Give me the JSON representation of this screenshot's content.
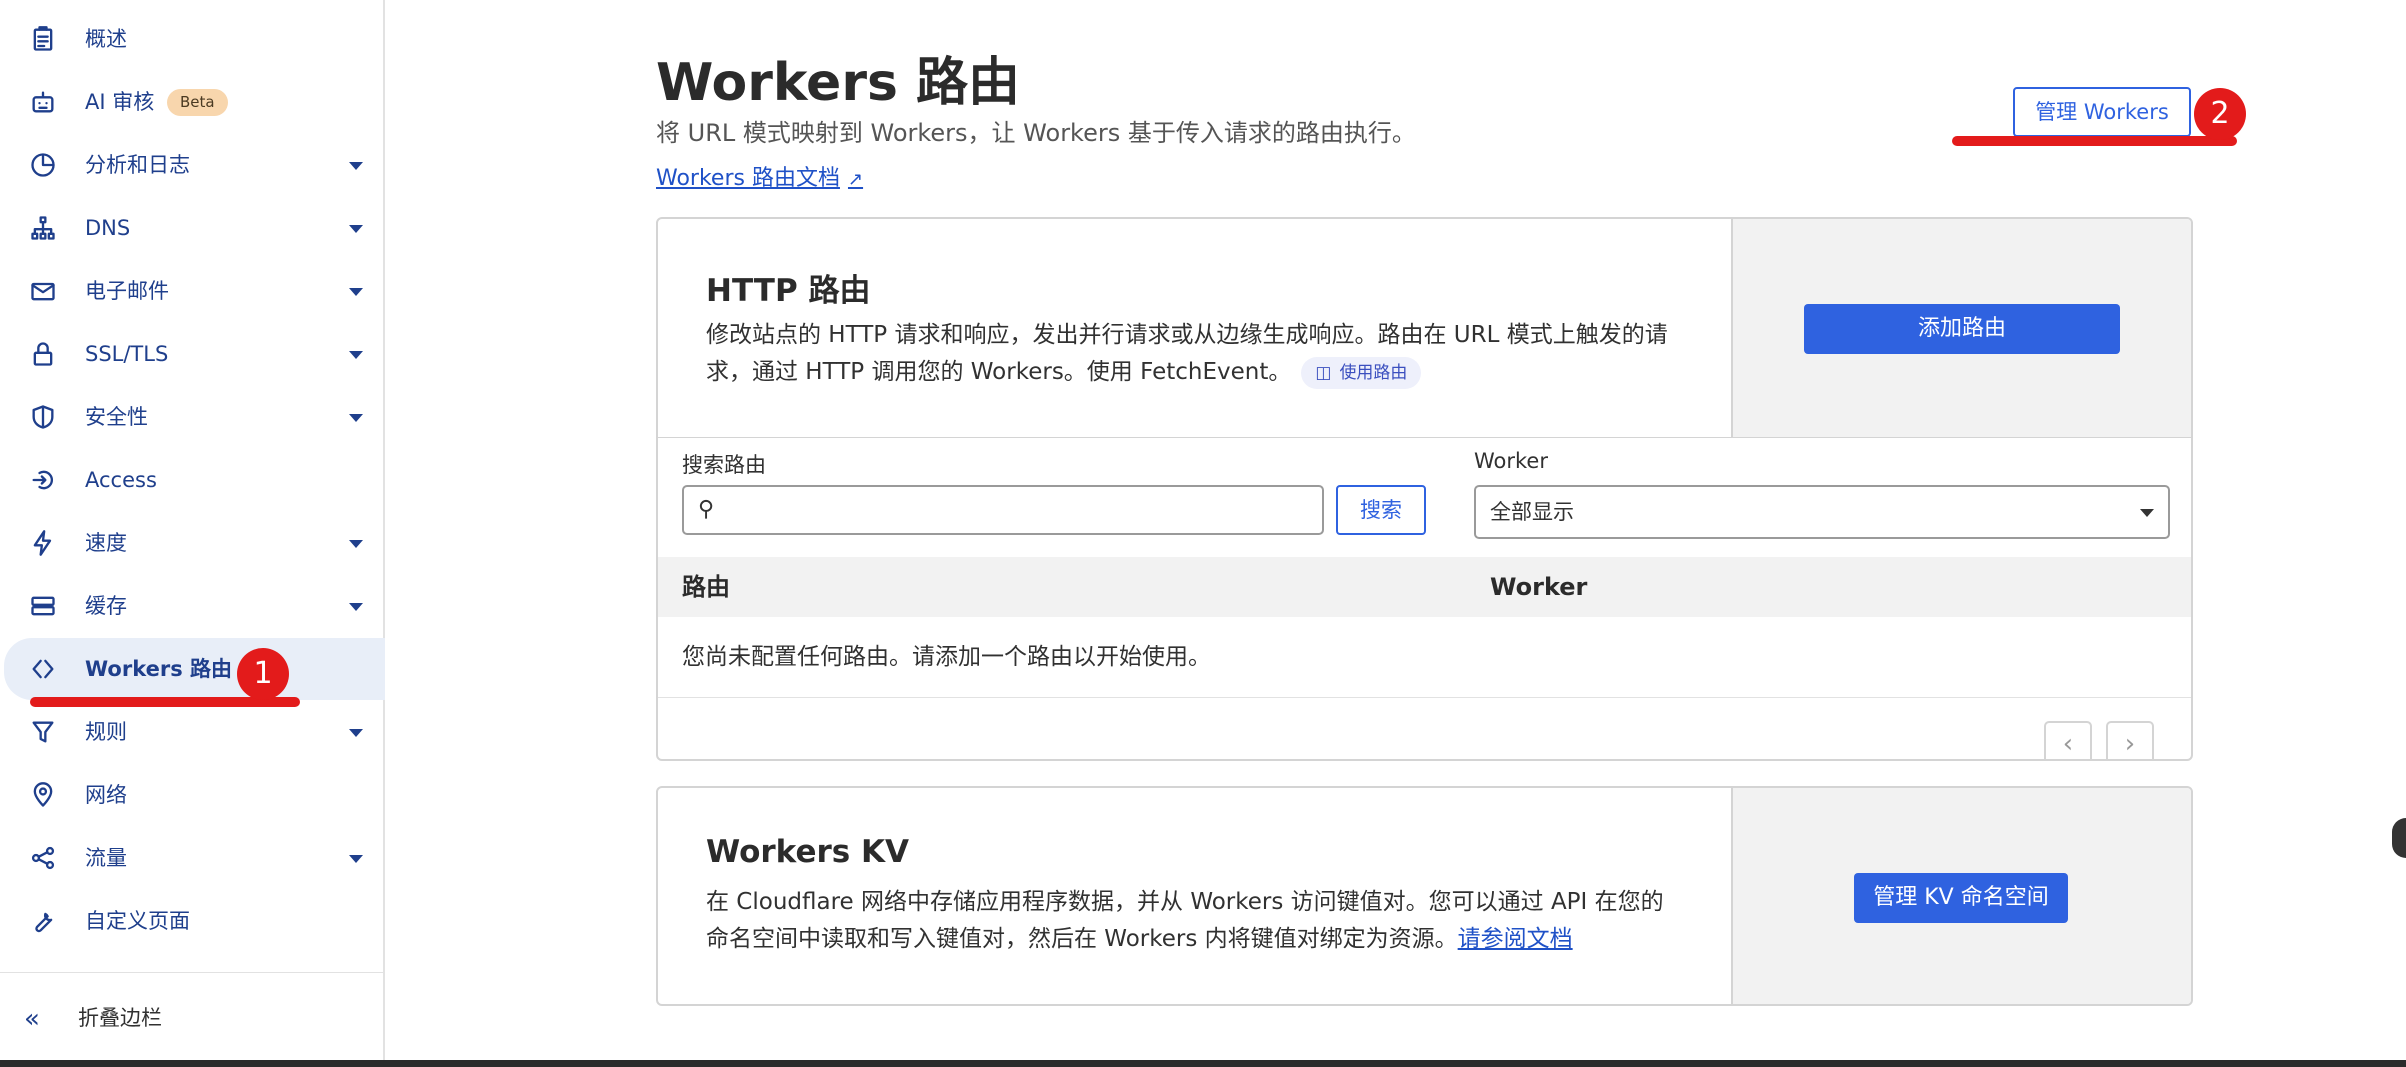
{
  "sidebar": {
    "items": [
      {
        "label": "概述",
        "icon": "clipboard-icon",
        "has_caret": false
      },
      {
        "label": "AI 审核",
        "icon": "robot-icon",
        "badge": "Beta",
        "has_caret": false
      },
      {
        "label": "分析和日志",
        "icon": "pie-chart-icon",
        "has_caret": true
      },
      {
        "label": "DNS",
        "icon": "network-icon",
        "has_caret": true
      },
      {
        "label": "电子邮件",
        "icon": "mail-icon",
        "has_caret": true
      },
      {
        "label": "SSL/TLS",
        "icon": "lock-icon",
        "has_caret": true
      },
      {
        "label": "安全性",
        "icon": "shield-icon",
        "has_caret": true
      },
      {
        "label": "Access",
        "icon": "access-icon",
        "has_caret": false
      },
      {
        "label": "速度",
        "icon": "lightning-icon",
        "has_caret": true
      },
      {
        "label": "缓存",
        "icon": "storage-icon",
        "has_caret": true
      },
      {
        "label": "Workers 路由",
        "icon": "code-brackets-icon",
        "has_caret": false,
        "active": true
      },
      {
        "label": "规则",
        "icon": "funnel-icon",
        "has_caret": true
      },
      {
        "label": "网络",
        "icon": "location-pin-icon",
        "has_caret": false
      },
      {
        "label": "流量",
        "icon": "share-nodes-icon",
        "has_caret": true
      },
      {
        "label": "自定义页面",
        "icon": "wrench-icon",
        "has_caret": false
      }
    ],
    "collapse_label": "折叠边栏"
  },
  "annotations": {
    "badge_1": "1",
    "badge_2": "2",
    "color": "#e31b1b"
  },
  "header": {
    "title": "Workers 路由",
    "description": "将 URL 模式映射到 Workers，让 Workers 基于传入请求的路由执行。",
    "doc_link": "Workers 路由文档",
    "manage_button": "管理 Workers"
  },
  "http_card": {
    "title": "HTTP 路由",
    "text": "修改站点的 HTTP 请求和响应，发出并行请求或从边缘生成响应。路由在 URL 模式上触发的请求，通过 HTTP 调用您的 Workers。使用 FetchEvent。",
    "pill": "使用路由",
    "add_button": "添加路由"
  },
  "routes": {
    "search_label": "搜索路由",
    "search_value": "",
    "search_button": "搜索",
    "worker_label": "Worker",
    "worker_select_value": "全部显示",
    "columns": [
      "路由",
      "Worker"
    ],
    "empty_message": "您尚未配置任何路由。请添加一个路由以开始使用。",
    "prev": "‹",
    "next": "›"
  },
  "kv_card": {
    "title": "Workers KV",
    "text": "在 Cloudflare 网络中存储应用程序数据，并从 Workers 访问键值对。您可以通过 API 在您的命名空间中读取和写入键值对，然后在 Workers 内将键值对绑定为资源。",
    "link": "请参阅文档",
    "button": "管理 KV 命名空间"
  },
  "colors": {
    "accent": "#2f62e0",
    "sidebar_text": "#1f3f8c",
    "active_bg": "#e8eef8"
  }
}
